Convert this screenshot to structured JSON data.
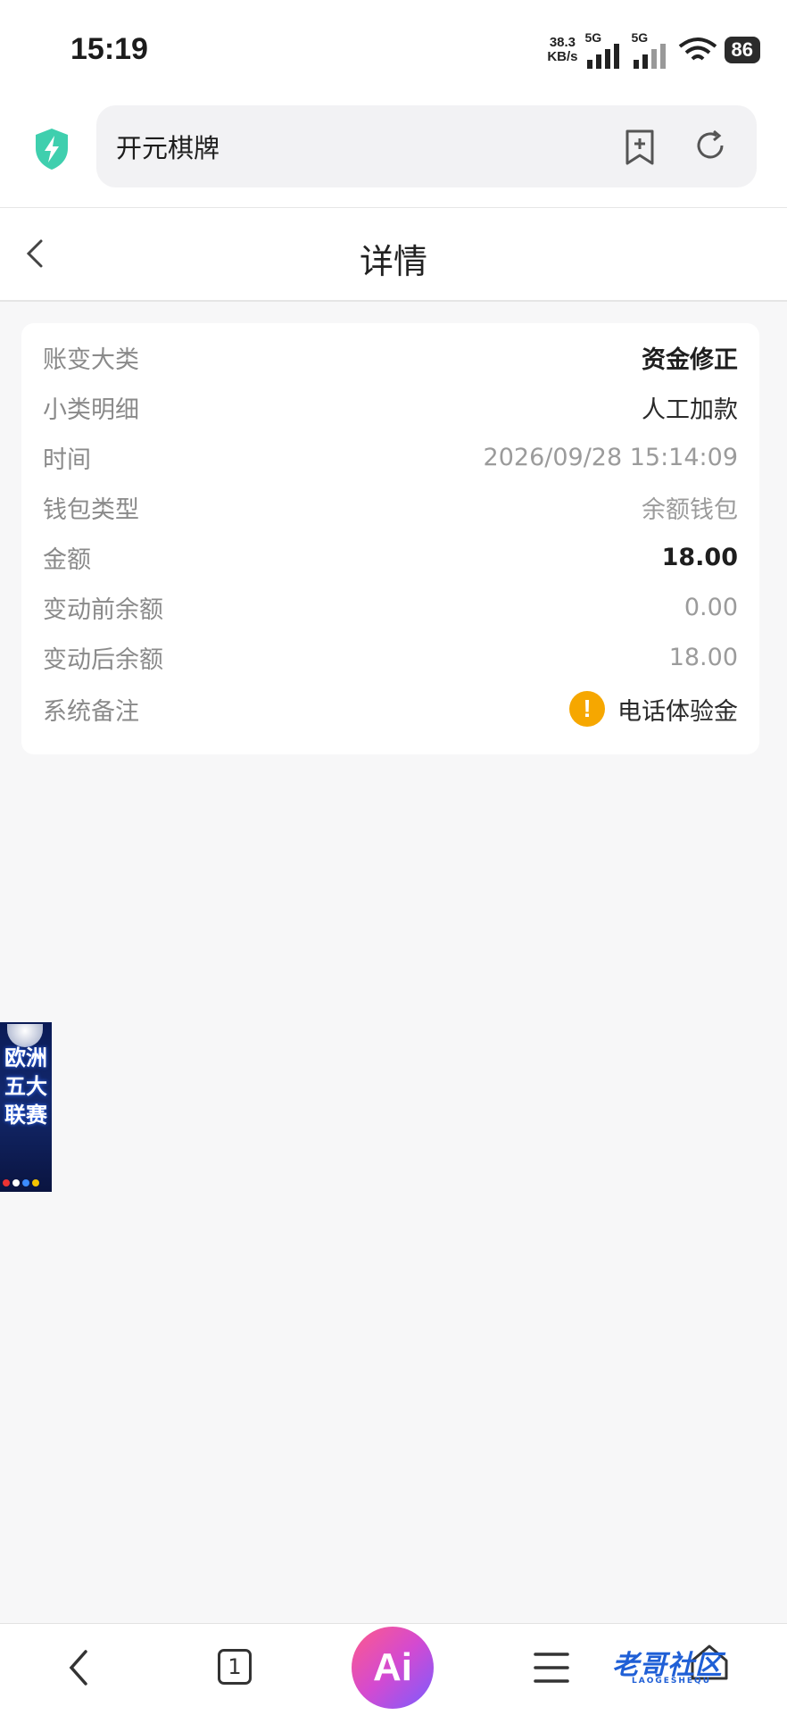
{
  "status_bar": {
    "time": "15:19",
    "net_speed": "38.3",
    "net_unit": "KB/s",
    "signal1_label": "5G",
    "signal2_label": "5G",
    "battery": "86"
  },
  "browser": {
    "url_text": "开元棋牌",
    "icons": [
      "shield-bolt-icon",
      "bookmark-add-icon",
      "reload-icon"
    ]
  },
  "header": {
    "title": "详情"
  },
  "details": [
    {
      "label": "账变大类",
      "value": "资金修正"
    },
    {
      "label": "小类明细",
      "value": "人工加款"
    },
    {
      "label": "时间",
      "value": "2026/09/28 15:14:09"
    },
    {
      "label": "钱包类型",
      "value": "余额钱包"
    },
    {
      "label": "金额",
      "value": "18.00"
    },
    {
      "label": "变动前余额",
      "value": "0.00"
    },
    {
      "label": "变动后余额",
      "value": "18.00"
    },
    {
      "label": "系统备注",
      "value": "电话体验金"
    }
  ],
  "remark_icon": "!",
  "promo": {
    "text": "欧洲五大联赛"
  },
  "bottom_nav": {
    "tab_count": "1",
    "ai_label": "Ai",
    "watermark": "老哥社区",
    "watermark_sub": "LAOGESHEQU"
  },
  "colors": {
    "accent_shield": "#3fcfae",
    "warning": "#f6a700",
    "watermark": "#1f5fd6"
  }
}
